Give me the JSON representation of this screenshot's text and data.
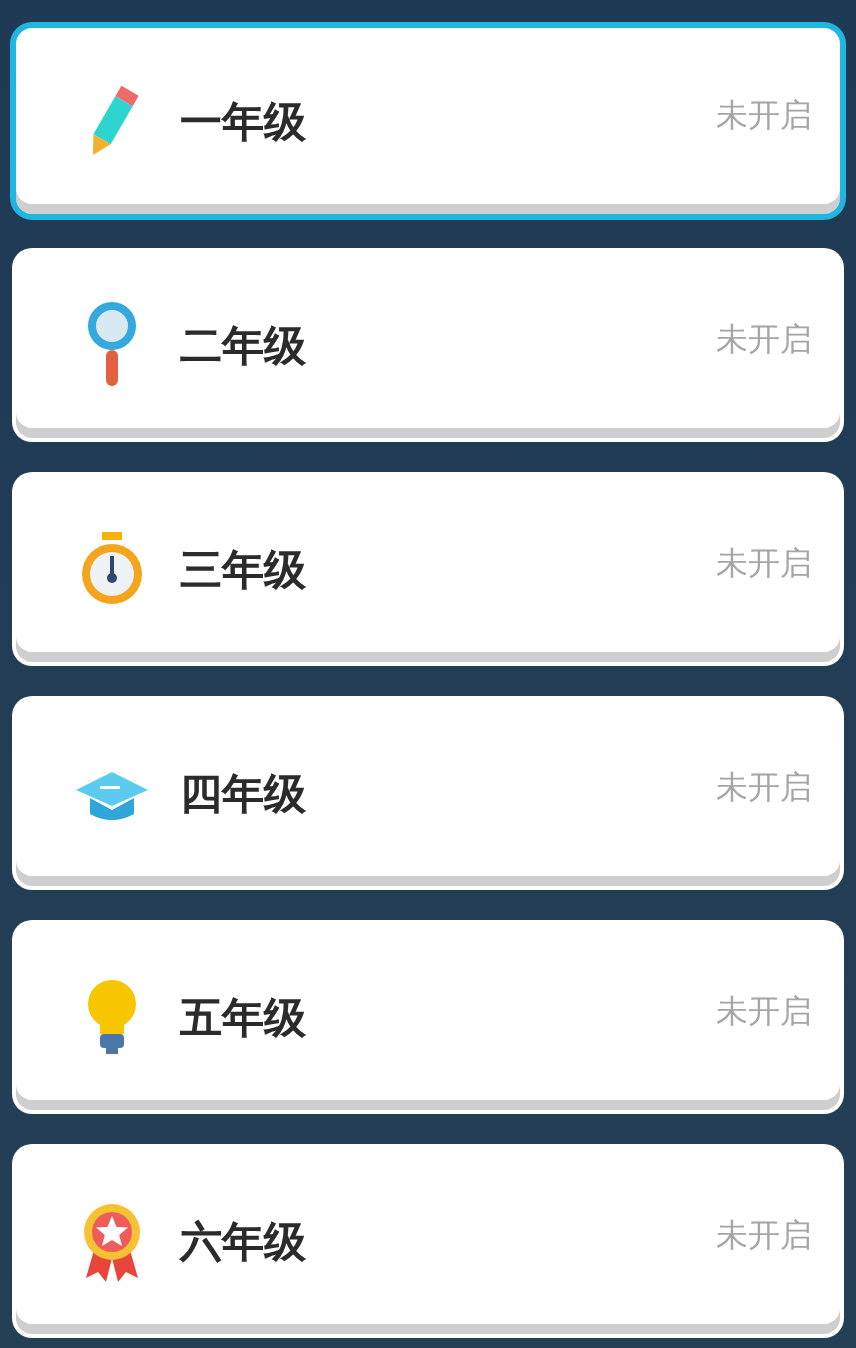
{
  "grades": [
    {
      "label": "一年级",
      "status": "未开启",
      "selected": true
    },
    {
      "label": "二年级",
      "status": "未开启",
      "selected": false
    },
    {
      "label": "三年级",
      "status": "未开启",
      "selected": false
    },
    {
      "label": "四年级",
      "status": "未开启",
      "selected": false
    },
    {
      "label": "五年级",
      "status": "未开启",
      "selected": false
    },
    {
      "label": "六年级",
      "status": "未开启",
      "selected": false
    }
  ]
}
